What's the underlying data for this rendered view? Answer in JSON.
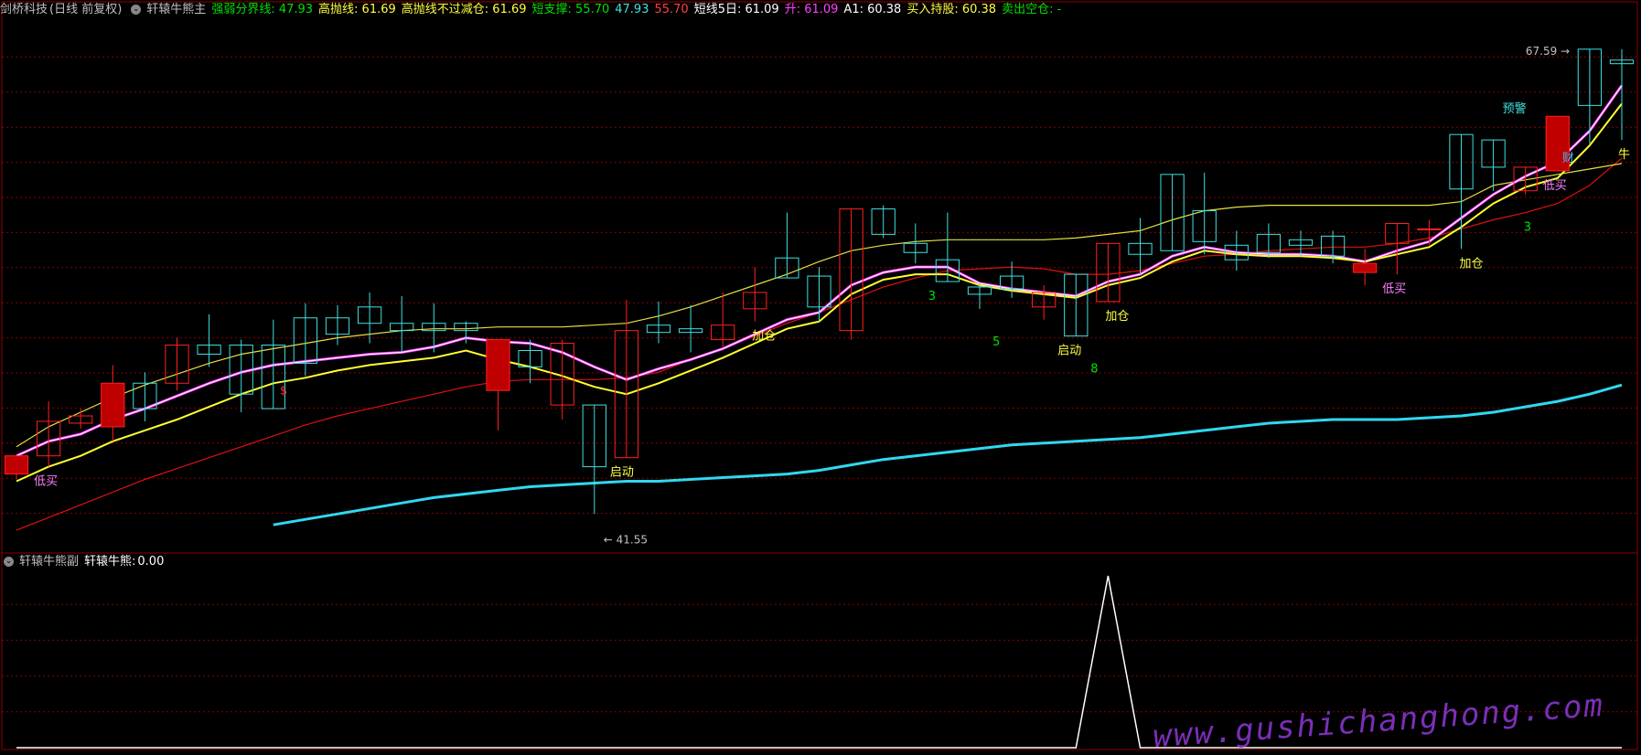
{
  "header": {
    "app": "剑桥科技",
    "period": "(日线 前复权)",
    "indicator": "轩辕牛熊主",
    "values": [
      {
        "label": "强弱分界线:",
        "value": "47.93",
        "color": "#00e000"
      },
      {
        "label": "高抛线:",
        "value": "61.69",
        "color": "#ffff40"
      },
      {
        "label": "高抛线不过减仓:",
        "value": "61.69",
        "color": "#ffff40"
      },
      {
        "label": "短支撑:",
        "value": "55.70",
        "color": "#00e000"
      },
      {
        "label": "",
        "value": "47.93",
        "color": "#40e0e0"
      },
      {
        "label": "",
        "value": "55.70",
        "color": "#ff4040"
      },
      {
        "label": "短线5日:",
        "value": "61.09",
        "color": "#ffffff"
      },
      {
        "label": "升:",
        "value": "61.09",
        "color": "#ff40ff"
      },
      {
        "label": "A1:",
        "value": "60.38",
        "color": "#ffffff"
      },
      {
        "label": "买入持股:",
        "value": "60.38",
        "color": "#ffff40"
      },
      {
        "label": "卖出空仓:",
        "value": "-",
        "color": "#00e000"
      }
    ]
  },
  "sub_header": {
    "indicator": "轩辕牛熊副",
    "label": "轩辕牛熊:",
    "value": "0.00"
  },
  "annotations": {
    "high_price": "67.59",
    "low_price": "41.55",
    "labels": [
      "低买",
      "启动",
      "加仓",
      "启动",
      "加仓",
      "低买",
      "加仓",
      "预警",
      "低买",
      "牛",
      "3",
      "5",
      "8",
      "3",
      "$",
      "财"
    ]
  },
  "watermark": "www.gushichanghong.com",
  "colors": {
    "up": "#ff2020",
    "down": "#40e0e0",
    "grid": "#8b0000",
    "cyan_line": "#30d8f0"
  },
  "chart_data": [
    {
      "type": "candlestick",
      "title": "",
      "series": [
        {
          "name": "K",
          "ohlc": [
            [
              44.6,
              45.6,
              44.3,
              45.6
            ],
            [
              45.6,
              47.5,
              45.0,
              48.6
            ],
            [
              47.4,
              47.8,
              47.1,
              48.2
            ],
            [
              47.2,
              49.6,
              46.4,
              50.6
            ],
            [
              49.6,
              48.2,
              47.5,
              50.2
            ],
            [
              49.6,
              51.7,
              49.2,
              52.1
            ],
            [
              51.7,
              51.2,
              50.5,
              53.4
            ],
            [
              51.7,
              49.0,
              48.0,
              52.0
            ],
            [
              51.7,
              48.2,
              48.2,
              53.1
            ],
            [
              53.2,
              50.7,
              50.0,
              54.0
            ],
            [
              53.2,
              52.3,
              51.7,
              53.9
            ],
            [
              53.8,
              52.9,
              51.8,
              54.6
            ],
            [
              52.9,
              52.5,
              51.3,
              54.4
            ],
            [
              52.9,
              52.5,
              51.3,
              54.0
            ],
            [
              52.9,
              52.5,
              51.8,
              53.0
            ],
            [
              49.2,
              52.0,
              47.0,
              52.0
            ],
            [
              51.4,
              50.5,
              49.6,
              52.0
            ],
            [
              48.4,
              51.8,
              47.6,
              52.0
            ],
            [
              48.4,
              45.0,
              42.4,
              48.4
            ],
            [
              45.5,
              52.5,
              45.5,
              54.2
            ],
            [
              52.8,
              52.4,
              51.8,
              54.1
            ],
            [
              52.6,
              52.4,
              51.3,
              53.9
            ],
            [
              52.0,
              52.8,
              51.6,
              54.6
            ],
            [
              53.7,
              54.6,
              53.0,
              56.0
            ],
            [
              56.5,
              55.4,
              55.4,
              59.0
            ],
            [
              55.5,
              53.8,
              53.0,
              56.0
            ],
            [
              52.5,
              59.2,
              52.0,
              59.2
            ],
            [
              59.2,
              57.8,
              57.6,
              59.4
            ],
            [
              57.3,
              56.8,
              56.2,
              58.4
            ],
            [
              56.4,
              55.2,
              55.2,
              59.0
            ],
            [
              54.9,
              54.5,
              53.7,
              55.1
            ],
            [
              55.5,
              54.8,
              54.3,
              56.3
            ],
            [
              53.8,
              54.6,
              53.1,
              55.0
            ],
            [
              55.6,
              52.2,
              52.2,
              55.6
            ],
            [
              54.1,
              57.3,
              54.1,
              57.3
            ],
            [
              57.3,
              56.7,
              55.6,
              58.7
            ],
            [
              61.1,
              56.9,
              56.9,
              61.1
            ],
            [
              59.1,
              57.4,
              56.7,
              61.2
            ],
            [
              57.2,
              56.4,
              55.8,
              58.0
            ],
            [
              57.8,
              56.8,
              56.5,
              58.4
            ],
            [
              57.5,
              57.2,
              56.6,
              58.0
            ],
            [
              57.7,
              56.6,
              56.2,
              58.0
            ],
            [
              55.7,
              56.2,
              55.0,
              57.0
            ],
            [
              57.3,
              58.4,
              55.6,
              58.4
            ],
            [
              58.1,
              58.1,
              57.2,
              58.6
            ],
            [
              63.3,
              60.3,
              57.0,
              63.3
            ],
            [
              63.0,
              61.5,
              60.2,
              63.0
            ],
            [
              60.2,
              61.5,
              60.0,
              61.5
            ],
            [
              61.3,
              64.3,
              61.3,
              64.3
            ],
            [
              68.0,
              64.9,
              62.8,
              68.0
            ],
            [
              67.4,
              67.2,
              63.0,
              68.0
            ]
          ]
        },
        {
          "name": "白线",
          "values": [
            45.6,
            46.4,
            46.8,
            47.6,
            48.2,
            48.9,
            49.6,
            50.2,
            50.6,
            50.8,
            51.0,
            51.2,
            51.3,
            51.6,
            52.1,
            51.9,
            51.8,
            51.3,
            50.5,
            49.8,
            50.4,
            50.9,
            51.5,
            52.3,
            53.1,
            53.5,
            55.0,
            55.7,
            56.0,
            56.0,
            55.1,
            54.8,
            54.6,
            54.4,
            55.2,
            55.6,
            56.6,
            57.1,
            56.8,
            56.7,
            56.7,
            56.6,
            56.3,
            56.9,
            57.4,
            58.7,
            60.0,
            61.0,
            61.8,
            63.5,
            66.0
          ]
        },
        {
          "name": "升",
          "values": [
            45.6,
            46.4,
            46.8,
            47.6,
            48.2,
            48.9,
            49.6,
            50.2,
            50.6,
            50.8,
            51.0,
            51.2,
            51.3,
            51.6,
            52.1,
            51.9,
            51.8,
            51.3,
            50.5,
            49.8,
            50.4,
            50.9,
            51.5,
            52.3,
            53.1,
            53.5,
            55.0,
            55.7,
            56.0,
            56.0,
            55.1,
            54.8,
            54.6,
            54.4,
            55.2,
            55.6,
            56.6,
            57.1,
            56.8,
            56.7,
            56.7,
            56.6,
            56.3,
            56.9,
            57.4,
            58.7,
            60.0,
            61.0,
            61.8,
            63.5,
            66.0
          ]
        },
        {
          "name": "买入持股",
          "values": [
            44.2,
            45.0,
            45.6,
            46.4,
            47.0,
            47.6,
            48.3,
            49.0,
            49.6,
            49.9,
            50.3,
            50.6,
            50.8,
            51.0,
            51.4,
            50.9,
            50.5,
            50.0,
            49.4,
            49.0,
            49.6,
            50.3,
            51.0,
            51.8,
            52.6,
            53.0,
            54.5,
            55.3,
            55.6,
            55.6,
            55.0,
            54.7,
            54.5,
            54.3,
            55.0,
            55.4,
            56.3,
            56.9,
            56.7,
            56.6,
            56.6,
            56.5,
            56.3,
            56.7,
            57.1,
            58.2,
            59.5,
            60.4,
            60.9,
            62.7,
            65.0
          ]
        },
        {
          "name": "高抛线",
          "values": [
            46.1,
            47.2,
            48.0,
            48.8,
            49.5,
            50.1,
            50.7,
            51.2,
            51.5,
            51.8,
            52.1,
            52.3,
            52.5,
            52.6,
            52.6,
            52.7,
            52.7,
            52.7,
            52.8,
            52.9,
            53.3,
            53.8,
            54.4,
            55.0,
            55.6,
            56.3,
            56.9,
            57.2,
            57.4,
            57.5,
            57.5,
            57.5,
            57.5,
            57.6,
            57.8,
            58.0,
            58.6,
            59.1,
            59.3,
            59.4,
            59.4,
            59.4,
            59.4,
            59.4,
            59.4,
            59.6,
            60.5,
            60.8,
            61.1,
            61.4,
            61.7
          ]
        },
        {
          "name": "红线",
          "values": [
            41.5,
            42.2,
            42.9,
            43.6,
            44.3,
            44.9,
            45.5,
            46.1,
            46.7,
            47.3,
            47.8,
            48.2,
            48.6,
            49.0,
            49.4,
            49.7,
            49.8,
            49.8,
            49.8,
            49.9,
            50.2,
            50.9,
            51.5,
            52.2,
            52.9,
            53.5,
            54.2,
            54.9,
            55.4,
            55.8,
            55.9,
            56.0,
            55.9,
            55.6,
            55.6,
            55.8,
            56.2,
            56.6,
            56.7,
            56.9,
            57.0,
            57.1,
            57.1,
            57.3,
            57.6,
            58.1,
            58.6,
            59.0,
            59.5,
            60.5,
            62.0
          ]
        },
        {
          "name": "强弱分界线",
          "values": [
            null,
            null,
            null,
            null,
            null,
            null,
            null,
            null,
            41.8,
            42.1,
            42.4,
            42.7,
            43.0,
            43.3,
            43.5,
            43.7,
            43.9,
            44.0,
            44.1,
            44.2,
            44.2,
            44.3,
            44.4,
            44.5,
            44.6,
            44.8,
            45.1,
            45.4,
            45.6,
            45.8,
            46.0,
            46.2,
            46.3,
            46.4,
            46.5,
            46.6,
            46.8,
            47.0,
            47.2,
            47.4,
            47.5,
            47.6,
            47.6,
            47.6,
            47.7,
            47.8,
            48.0,
            48.3,
            48.6,
            49.0,
            49.5
          ]
        }
      ],
      "ylim": [
        40.5,
        69.5
      ]
    },
    {
      "type": "line",
      "title": "",
      "series": [
        {
          "name": "轩辕牛熊",
          "values": [
            0,
            0,
            0,
            0,
            0,
            0,
            0,
            0,
            0,
            0,
            0,
            0,
            0,
            0,
            0,
            0,
            0,
            0,
            0,
            0,
            0,
            0,
            0,
            0,
            0,
            0,
            0,
            0,
            0,
            0,
            0,
            0,
            0,
            0,
            1,
            0,
            0,
            0,
            0,
            0,
            0,
            0,
            0,
            0,
            0,
            0,
            0,
            0,
            0,
            0,
            0
          ]
        }
      ],
      "ylim": [
        0,
        1
      ]
    }
  ]
}
